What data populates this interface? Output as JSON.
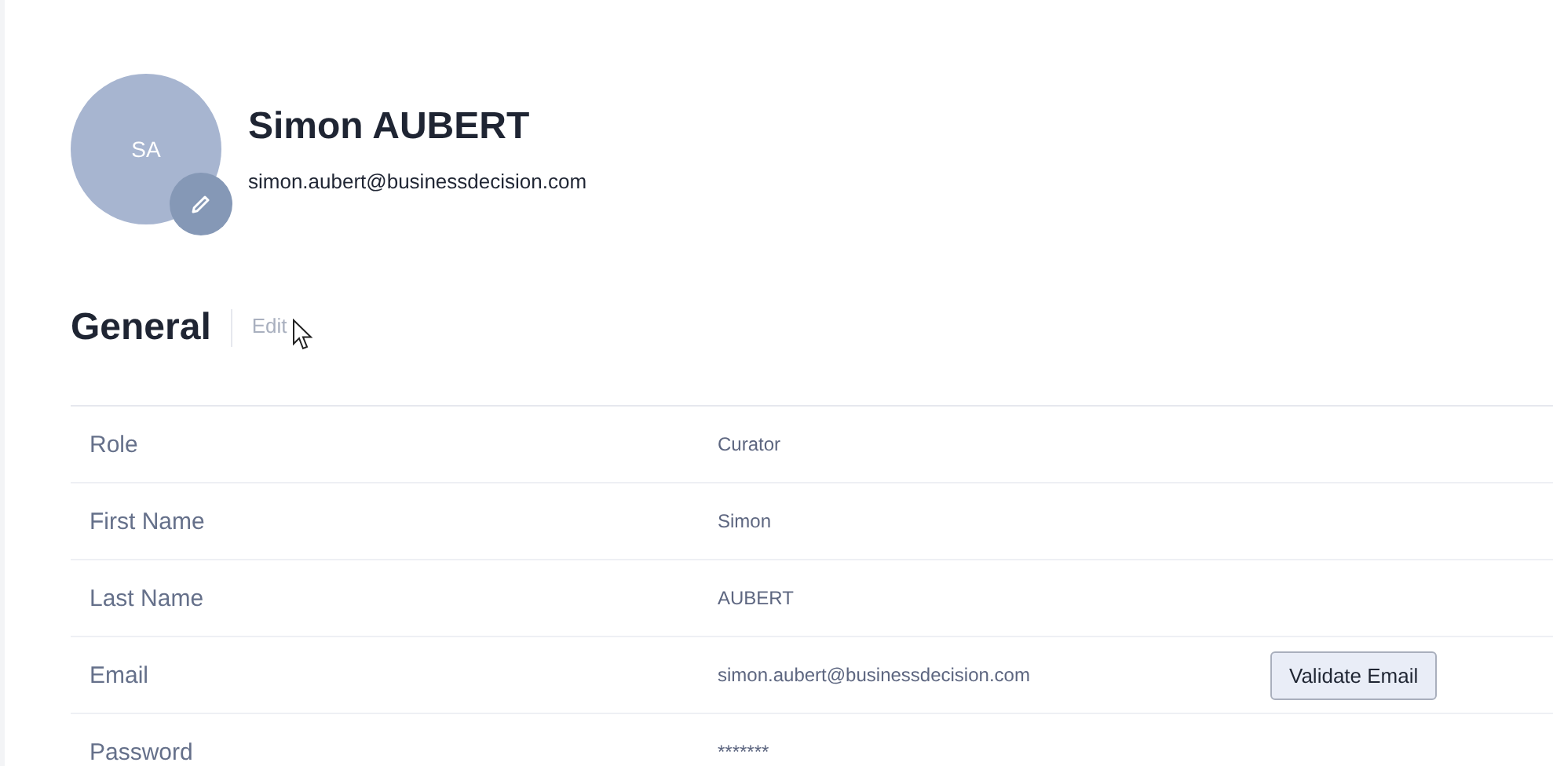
{
  "profile": {
    "initials": "SA",
    "name": "Simon AUBERT",
    "email": "simon.aubert@businessdecision.com"
  },
  "section": {
    "title": "General",
    "edit": {
      "label": "Edit",
      "disabled": true
    }
  },
  "rows": [
    {
      "label": "Role",
      "value": "Curator"
    },
    {
      "label": "First Name",
      "value": "Simon"
    },
    {
      "label": "Last Name",
      "value": "AUBERT"
    },
    {
      "label": "Email",
      "value": "simon.aubert@businessdecision.com",
      "action": "Validate Email"
    },
    {
      "label": "Password",
      "value": "*******"
    }
  ]
}
